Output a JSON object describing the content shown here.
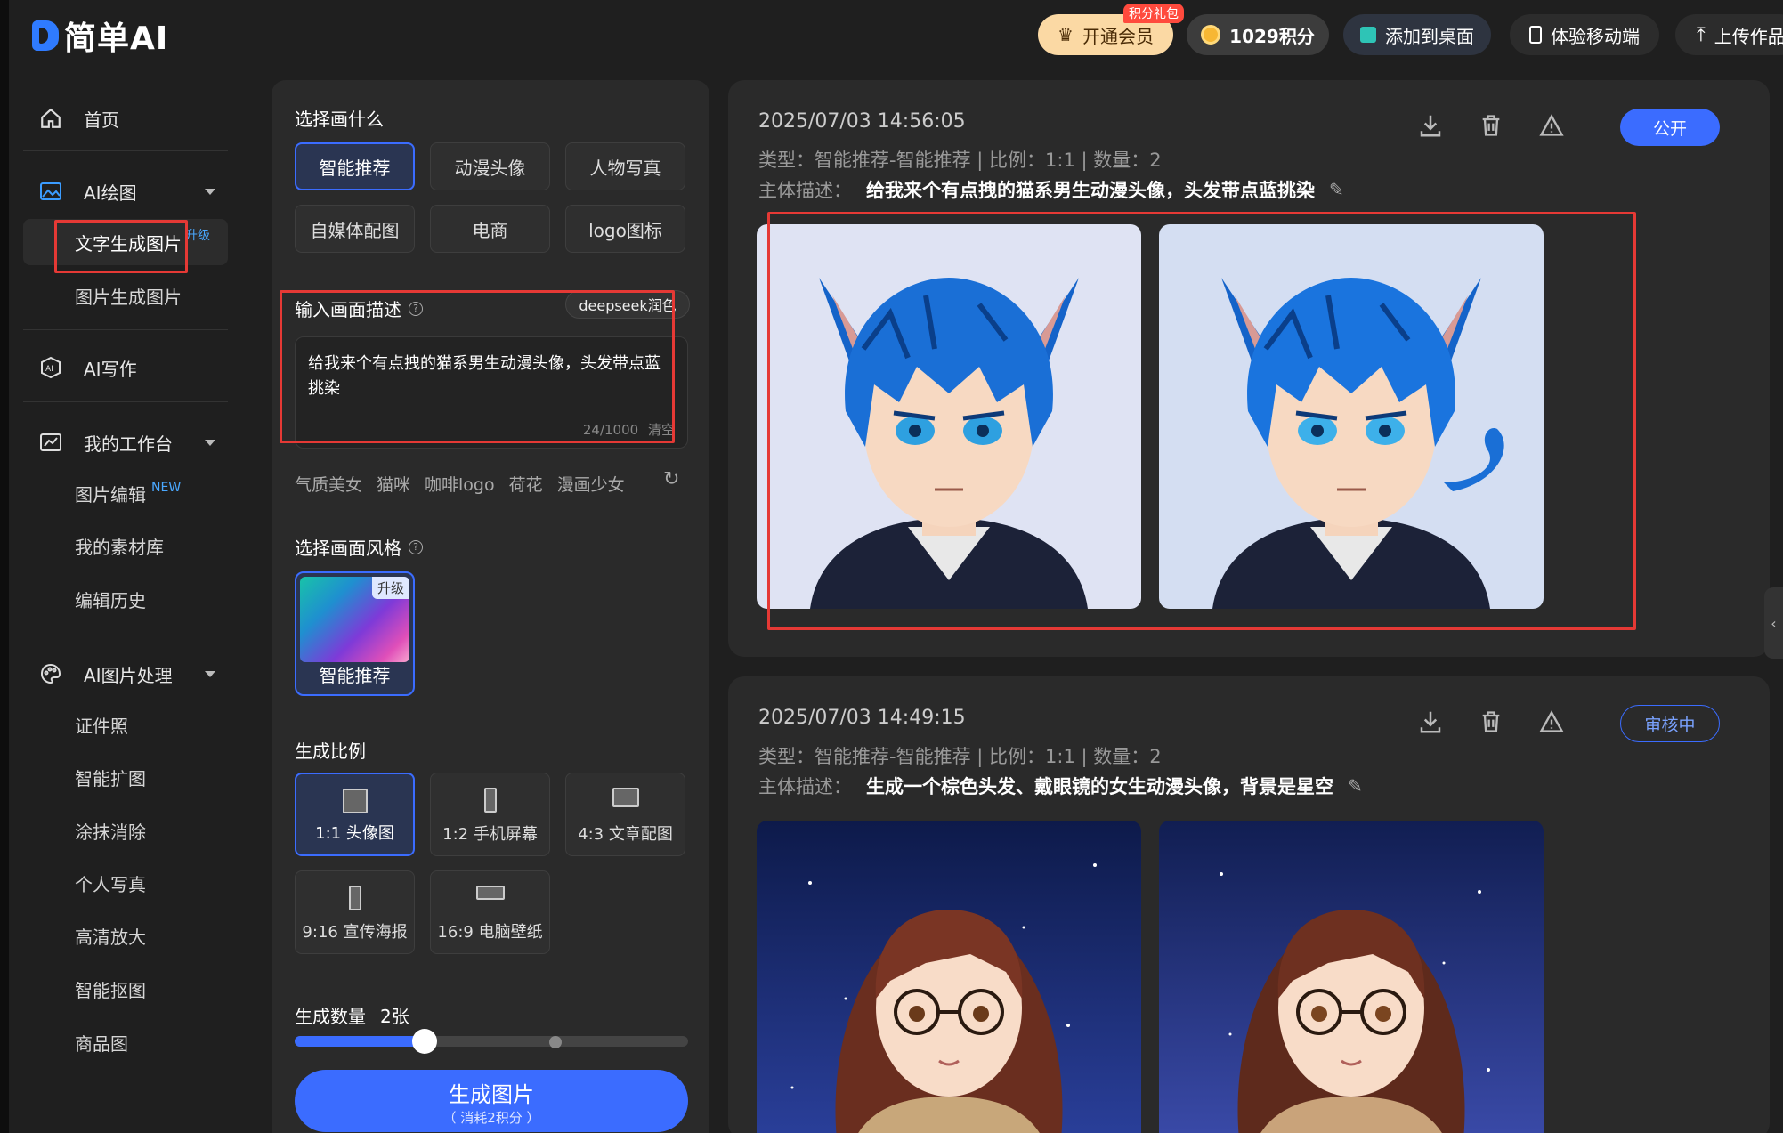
{
  "app": {
    "logo_text": "简单AI"
  },
  "header": {
    "vip_label": "开通会员",
    "vip_badge": "积分礼包",
    "points_label": "1029积分",
    "desktop_label": "添加到桌面",
    "mobile_label": "体验移动端",
    "upload_label": "上传作品"
  },
  "sidebar": {
    "home": "首页",
    "ai_draw": "AI绘图",
    "text_to_image": "文字生成图片",
    "text_to_image_tag": "升级",
    "image_to_image": "图片生成图片",
    "ai_write": "AI写作",
    "workbench": "我的工作台",
    "image_edit": "图片编辑",
    "image_edit_tag": "NEW",
    "materials": "我的素材库",
    "edit_history": "编辑历史",
    "ai_image_process": "AI图片处理",
    "id_photo": "证件照",
    "smart_expand": "智能扩图",
    "erase": "涂抹消除",
    "portrait": "个人写真",
    "upscale": "高清放大",
    "cutout": "智能抠图",
    "product": "商品图"
  },
  "panel": {
    "what_title": "选择画什么",
    "what_options": [
      "智能推荐",
      "动漫头像",
      "人物写真",
      "自媒体配图",
      "电商",
      "logo图标"
    ],
    "desc_title": "输入画面描述",
    "deepseek_label": "deepseek润色",
    "prompt_text": "给我来个有点拽的猫系男生动漫头像，头发带点蓝挑染",
    "prompt_count": "24/1000",
    "clear_label": "清空",
    "suggestions": [
      "气质美女",
      "猫咪",
      "咖啡logo",
      "荷花",
      "漫画少女"
    ],
    "style_title": "选择画面风格",
    "style_badge": "升级",
    "style_name": "智能推荐",
    "ratio_title": "生成比例",
    "ratios": [
      "1:1 头像图",
      "1:2 手机屏幕",
      "4:3 文章配图",
      "9:16 宣传海报",
      "16:9 电脑壁纸"
    ],
    "count_title": "生成数量",
    "count_value": "2张",
    "count_slider_fraction": 0.33,
    "gen_label": "生成图片",
    "gen_cost": "（ 消耗2积分 ）"
  },
  "results": [
    {
      "date": "2025/07/03 14:56:05",
      "meta": "类型：智能推荐-智能推荐 | 比例：1:1 | 数量：2",
      "desc_label": "主体描述：",
      "desc_text": "给我来个有点拽的猫系男生动漫头像，头发带点蓝挑染",
      "status_label": "公开"
    },
    {
      "date": "2025/07/03 14:49:15",
      "meta": "类型：智能推荐-智能推荐 | 比例：1:1 | 数量：2",
      "desc_label": "主体描述：",
      "desc_text": "生成一个棕色头发、戴眼镜的女生动漫头像，背景是星空",
      "status_label": "审核中"
    }
  ],
  "colors": {
    "accent": "#3b6cff",
    "highlight_box": "#e53935"
  }
}
